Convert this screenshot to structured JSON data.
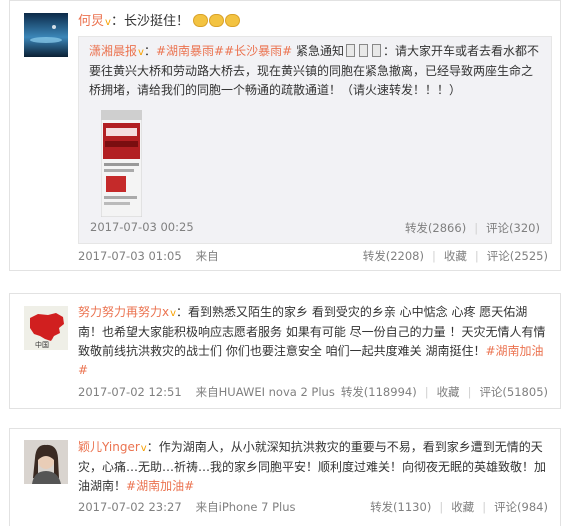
{
  "posts": [
    {
      "user": "何炅",
      "badge": "v",
      "text": "：长沙挺住！",
      "repost": {
        "user": "潇湘晨报",
        "badge": "v",
        "tags": "#湖南暴雨##长沙暴雨#",
        "lead": " 紧急通知",
        "text": "：请大家开车或者去看水都不要往黄兴大桥和劳动路大桥去，现在黄兴镇的同胞在紧急撤离，已经导致两座生命之桥拥堵，请给我们的同胞一个畅通的疏散通道！（请火速转发！！！）",
        "time": "2017-07-03 00:25",
        "forward": "转发(2866)",
        "comment": "评论(320)"
      },
      "time": "2017-07-03 01:05",
      "source": "来自",
      "forward": "转发(2208)",
      "fav": "收藏",
      "comment": "评论(2525)"
    },
    {
      "user": "努力努力再努力x",
      "badge": "v",
      "text": "：看到熟悉又陌生的家乡 看到受灾的乡亲 心中惦念 心疼 愿天佑湖南！也希望大家能积极响应志愿者服务 如果有可能 尽一份自己的力量 ！天灾无情人有情 致敬前线抗洪救灾的战士们 你们也要注意安全 咱们一起共度难关 湖南挺住！",
      "tag": "#湖南加油#",
      "time": "2017-07-02 12:51",
      "source": "来自HUAWEI nova 2 Plus",
      "forward": "转发(118994)",
      "fav": "收藏",
      "comment": "评论(51805)"
    },
    {
      "user": "颖儿Yinger",
      "badge": "v",
      "text": "：作为湖南人，从小就深知抗洪救灾的重要与不易，看到家乡遭到无情的天灾，心痛…无助…祈祷…我的家乡同胞平安！顺利度过难关！向彻夜无眠的英雄致敬！加油湖南！",
      "tag": "#湖南加油#",
      "time": "2017-07-02 23:27",
      "source": "来自iPhone 7 Plus",
      "forward": "转发(1130)",
      "fav": "收藏",
      "comment": "评论(984)"
    }
  ]
}
